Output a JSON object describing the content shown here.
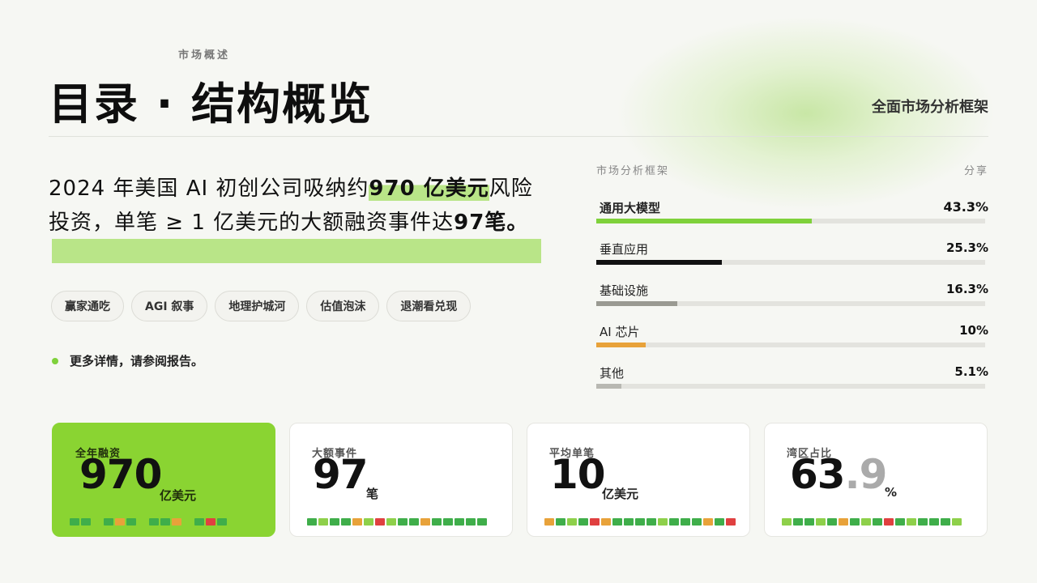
{
  "header": {
    "kicker": "市场概述",
    "title": "目录 · 结构概览",
    "subtitle": "全面市场分析框架"
  },
  "lead": {
    "part1": "2024 年美国 AI 初创公司吸纳约",
    "highlight1": "970 亿美元",
    "part2": "风险投资，单笔 ≥ 1 亿美元的大额融资事件达",
    "highlight2": "97",
    "part3": "笔。"
  },
  "tags": [
    "赢家通吃",
    "AGI 叙事",
    "地理护城河",
    "估值泡沫",
    "退潮看兑现"
  ],
  "more": {
    "label": "更多详情，请参阅报告。"
  },
  "panel": {
    "header_left": "市场分析框架",
    "header_right": "分享",
    "rows": [
      {
        "label": "通用大模型",
        "value": "43.3%",
        "share": 0.433,
        "color": "#7fd13b"
      },
      {
        "label": "垂直应用",
        "value": "25.3%",
        "share": 0.253,
        "color": "#111111"
      },
      {
        "label": "基础设施",
        "value": "16.3%",
        "share": 0.163,
        "color": "#9a9a92"
      },
      {
        "label": "AI 芯片",
        "value": "10%",
        "share": 0.1,
        "color": "#e8a23a"
      },
      {
        "label": "其他",
        "value": "5.1%",
        "share": 0.051,
        "color": "#b8b8b2"
      }
    ]
  },
  "cards": [
    {
      "label": "全年融资",
      "number": "970",
      "decimal": "",
      "unit": "亿美元",
      "squares": [
        "#3fae4a",
        "#3fae4a",
        "",
        "#3fae4a",
        "#e8a23a",
        "#3fae4a",
        "",
        "#3fae4a",
        "#3fae4a",
        "#e8a23a",
        "",
        "#3fae4a",
        "#e04040",
        "#3fae4a"
      ]
    },
    {
      "label": "大额事件",
      "number": "97",
      "decimal": "",
      "unit": "笔",
      "squares": [
        "#3fae4a",
        "#8ed04a",
        "#3fae4a",
        "#3fae4a",
        "#e8a23a",
        "#8ed04a",
        "#e04040",
        "#8ed04a",
        "#3fae4a",
        "#3fae4a",
        "#e8a23a",
        "#3fae4a",
        "#3fae4a",
        "#3fae4a",
        "#3fae4a",
        "#3fae4a"
      ]
    },
    {
      "label": "平均单笔",
      "number": "10",
      "decimal": "",
      "unit": "亿美元",
      "squares": [
        "#e8a23a",
        "#3fae4a",
        "#8ed04a",
        "#3fae4a",
        "#e04040",
        "#e8a23a",
        "#3fae4a",
        "#3fae4a",
        "#3fae4a",
        "#3fae4a",
        "#8ed04a",
        "#3fae4a",
        "#3fae4a",
        "#3fae4a",
        "#e8a23a",
        "#3fae4a",
        "#e04040"
      ]
    },
    {
      "label": "湾区占比",
      "number": "63",
      "decimal": ".9",
      "unit": "%",
      "squares": [
        "#8ed04a",
        "#3fae4a",
        "#3fae4a",
        "#8ed04a",
        "#3fae4a",
        "#e8a23a",
        "#3fae4a",
        "#8ed04a",
        "#3fae4a",
        "#e04040",
        "#3fae4a",
        "#8ed04a",
        "#3fae4a",
        "#3fae4a",
        "#3fae4a",
        "#8ed04a"
      ]
    }
  ]
}
